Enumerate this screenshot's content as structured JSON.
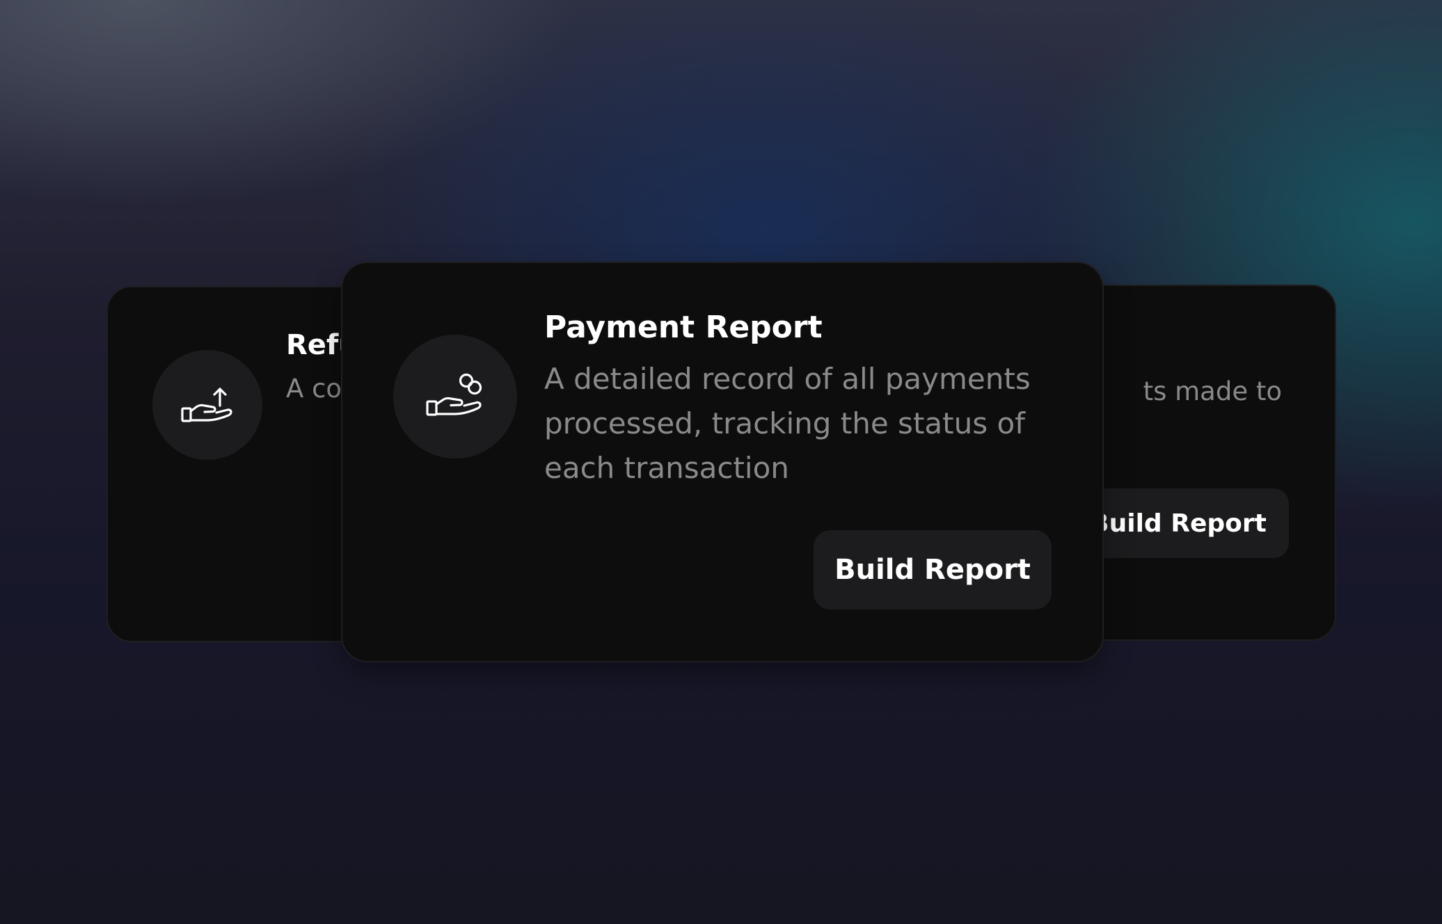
{
  "cards": {
    "left": {
      "title": "Refu",
      "description": "A co activ each",
      "icon": "hand-arrow-up-icon"
    },
    "center": {
      "title": "Payment Report",
      "description": " A detailed record of all payments processed, tracking the status of each transaction",
      "button_label": "Build Report",
      "icon": "hand-coins-icon"
    },
    "right": {
      "description": "ts made to",
      "button_label": "Build Report"
    }
  }
}
